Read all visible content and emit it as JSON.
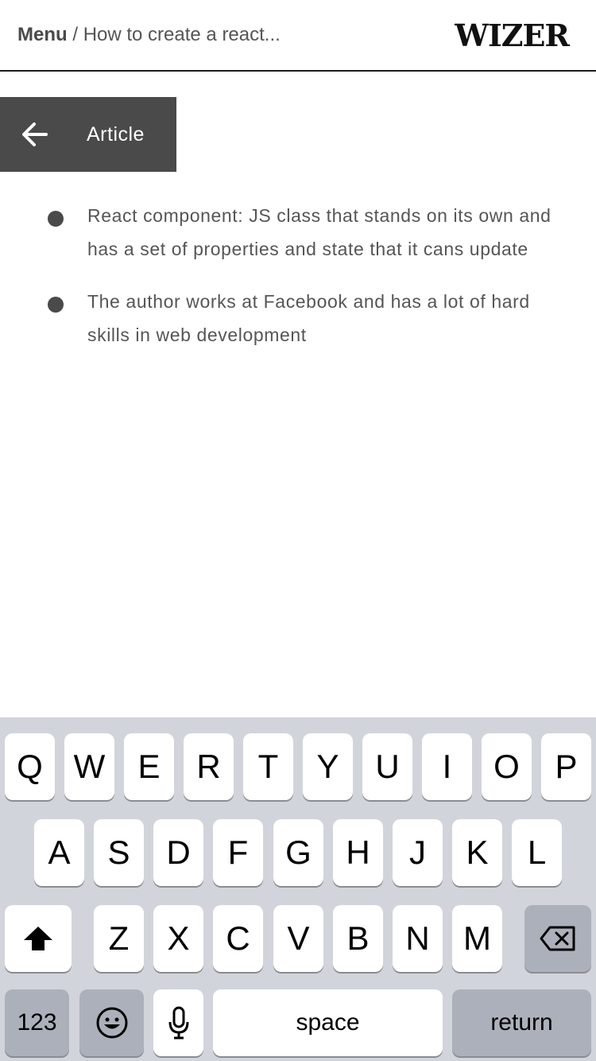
{
  "header": {
    "menu_label": "Menu",
    "separator": "/",
    "title": "How to create a react...",
    "logo": "WIZER"
  },
  "back_button": {
    "label": "Article",
    "icon": "arrow-left-icon"
  },
  "notes": [
    "React component: JS class that stands on its own and has a set of properties and state that it cans update",
    "The author works at Facebook and has a lot of hard skills in web development"
  ],
  "keyboard": {
    "row1": [
      "Q",
      "W",
      "E",
      "R",
      "T",
      "Y",
      "U",
      "I",
      "O",
      "P"
    ],
    "row2": [
      "A",
      "S",
      "D",
      "F",
      "G",
      "H",
      "J",
      "K",
      "L"
    ],
    "row3": [
      "Z",
      "X",
      "C",
      "V",
      "B",
      "N",
      "M"
    ],
    "shift_icon": "shift-icon",
    "backspace_icon": "backspace-icon",
    "numbers_label": "123",
    "emoji_icon": "emoji-icon",
    "mic_icon": "microphone-icon",
    "space_label": "space",
    "return_label": "return"
  },
  "colors": {
    "button_bg": "#4a4a4a",
    "keyboard_bg": "#d1d4db",
    "dark_key": "#abb0ba"
  }
}
